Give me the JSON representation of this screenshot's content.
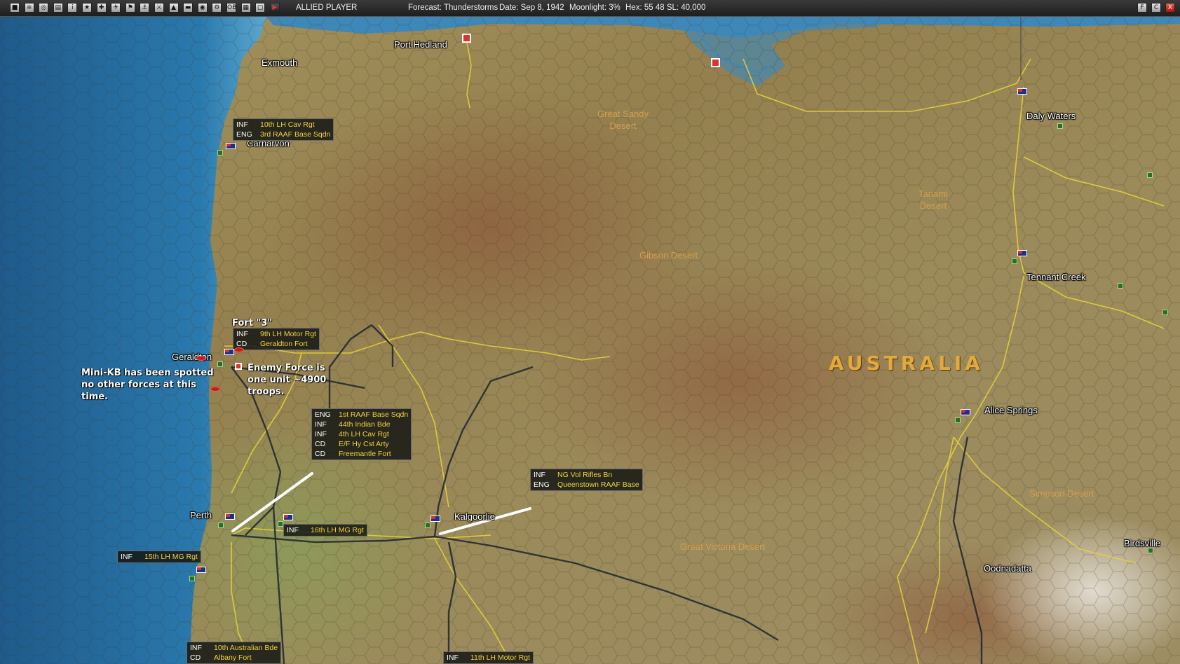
{
  "toolbar": {
    "icons": [
      "save-icon",
      "report-icon",
      "intel-icon",
      "list-icon",
      "info-icon",
      "star-icon",
      "ground-icon",
      "air-icon",
      "flag-icon",
      "naval-icon",
      "combat-icon",
      "supply-icon",
      "bridge-icon",
      "globe-icon",
      "settings-icon",
      "ob-icon",
      "grid-icon",
      "screen-icon",
      "end-turn-icon"
    ],
    "player": "ALLIED PLAYER",
    "forecast": "Forecast: Thunderstorms",
    "date": "Date: Sep 8, 1942",
    "moonlight": "Moonlight: 3%",
    "hex": "Hex: 55 48  SL: 40,000",
    "window_buttons": [
      "F",
      "C",
      "X"
    ]
  },
  "places": {
    "port_hedland": "Port Hedland",
    "exmouth": "Exmouth",
    "carnarvon": "Carnarvon",
    "geraldton": "Geraldton",
    "perth": "Perth",
    "kalgoorlie": "Kalgoorlie",
    "daly_waters": "Daly Waters",
    "tennant_creek": "Tennant Creek",
    "alice_springs": "Alice Springs",
    "birdsville": "Birdsville",
    "oodnadatta": "Oodnadatta"
  },
  "deserts": {
    "great_sandy": "Great Sandy\nDesert",
    "tanami": "Tanami\nDesert",
    "gibson": "Gibson Desert",
    "simpson": "Simpson Desert",
    "great_victoria": "Great Victoria Desert"
  },
  "country": "AUSTRALIA",
  "notes": {
    "fort": "Fort \"3\"",
    "enemy_force": "Enemy Force is\none unit ~4900\ntroops.",
    "mini_kb": "Mini-KB has been spotted\nno other forces at this\ntime."
  },
  "unit_groups": {
    "carnarvon": [
      {
        "type": "INF",
        "name": "10th LH Cav Rgt"
      },
      {
        "type": "ENG",
        "name": "3rd RAAF Base Sqdn"
      }
    ],
    "geraldton": [
      {
        "type": "INF",
        "name": "9th LH Motor Rgt"
      },
      {
        "type": "CD",
        "name": "Geraldton Fort"
      }
    ],
    "perth": [
      {
        "type": "ENG",
        "name": "1st RAAF Base Sqdn"
      },
      {
        "type": "INF",
        "name": "44th Indian Bde"
      },
      {
        "type": "INF",
        "name": "4th LH Cav Rgt"
      },
      {
        "type": "CD",
        "name": "E/F Hy Cst Arty"
      },
      {
        "type": "CD",
        "name": "Freemantle Fort"
      }
    ],
    "kalgoorlie": [
      {
        "type": "INF",
        "name": "NG Vol Rifles Bn"
      },
      {
        "type": "ENG",
        "name": "Queenstown RAAF Base"
      }
    ],
    "east_perth": [
      {
        "type": "INF",
        "name": "16th LH MG Rgt"
      }
    ],
    "bunbury": [
      {
        "type": "INF",
        "name": "15th LH MG Rgt"
      }
    ],
    "albany": [
      {
        "type": "INF",
        "name": "10th Australian Bde"
      },
      {
        "type": "CD",
        "name": "Albany Fort"
      }
    ],
    "south": [
      {
        "type": "INF",
        "name": "11th LH Motor Rgt"
      }
    ]
  },
  "colors": {
    "land": "#9a8a5a",
    "ocean": "#2a6a9a",
    "road": "#e3d23a",
    "rail": "#1c2430",
    "unit_name": "#f2d33a"
  }
}
